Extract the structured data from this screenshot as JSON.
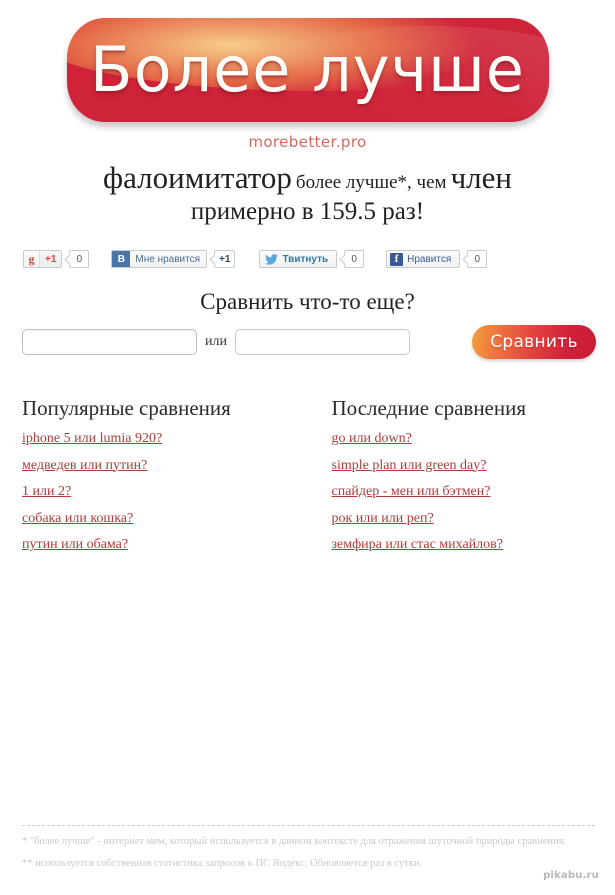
{
  "site": {
    "logo_text": "Более лучше",
    "logo_url": "morebetter.pro",
    "watermark": "pikabu.ru",
    "brand_red": "#cf2339",
    "brand_orange": "#f3a03c",
    "link_red": "#b23a3a"
  },
  "headline": {
    "subject_a": "фалоимитатор",
    "middle": "более лучше*, чем",
    "subject_b": "член",
    "line2": "примерно в 159.5 раз!",
    "ratio": "159.5"
  },
  "social": {
    "google": {
      "icon": "google-plus-icon",
      "glyph": "g",
      "plus_label": "+1",
      "count": "0"
    },
    "vk": {
      "icon": "vk-icon",
      "glyph": "В",
      "label": "Мне нравится",
      "count": "+1"
    },
    "twitter": {
      "icon": "twitter-bird-icon",
      "glyph": "🐦",
      "label": "Твитнуть",
      "count": "0"
    },
    "facebook": {
      "icon": "facebook-icon",
      "glyph": "f",
      "label": "Нравится",
      "count": "0"
    }
  },
  "compare": {
    "title": "Сравнить что-то еще?",
    "input_a_value": "",
    "input_a_placeholder": "",
    "or_label": "или",
    "input_b_value": "",
    "input_b_placeholder": "",
    "button_label": "Сравнить"
  },
  "popular": {
    "title": "Популярные сравнения",
    "links": [
      "iphone 5 или lumia 920?",
      "медведев или путин?",
      "1 или 2?",
      "собака или кошка?",
      "путин или обама?"
    ]
  },
  "latest": {
    "title": "Последние сравнения",
    "links": [
      "go или down?",
      "simple plan или green day?",
      "спайдер - мен или бэтмен?",
      "рок или или реп?",
      "земфира или стас михайлов?"
    ]
  },
  "footer": {
    "note1": "* \"более лучше\" - интернет мем, который используется в данном контексте для отражения шуточной природы сравнения.",
    "note2": "** используется собственная статистика запросов к ПС Яндекс. Обновляется раз в сутки."
  }
}
